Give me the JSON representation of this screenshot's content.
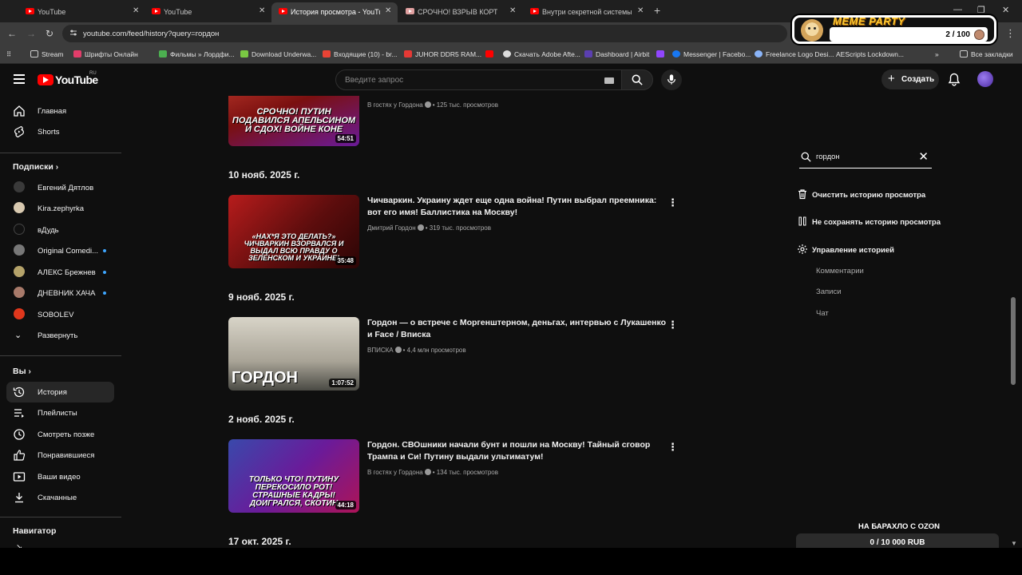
{
  "browser": {
    "tabs": [
      {
        "label": "YouTube",
        "active": false
      },
      {
        "label": "YouTube",
        "active": false
      },
      {
        "label": "История просмотра - YouTube",
        "active": true
      },
      {
        "label": "СРОЧНО! ВЗРЫВ КОРТЕЖА",
        "active": false
      },
      {
        "label": "Внутри секретной системы пр",
        "active": false
      }
    ],
    "url": "youtube.com/feed/history?query=гордон",
    "bookmarks": [
      "Stream",
      "Шрифты Онлайн",
      "Фильмы » Лордфи...",
      "Download Underwa...",
      "Входящие (10) - br...",
      "JUHOR DDR5 RAM...",
      "Скачать Adobe Afte...",
      "Dashboard | Airbit",
      "Messenger | Facebo...",
      "Freelance Logo Desi...",
      "AEScripts Lockdown...",
      "Все закладки"
    ]
  },
  "overlay": {
    "title": "MEME PARTY",
    "count": "2 / 100"
  },
  "header": {
    "logo_text": "YouTube",
    "logo_region": "RU",
    "search_placeholder": "Введите запрос",
    "create_label": "Создать"
  },
  "sidebar": {
    "main": [
      {
        "label": "Главная",
        "icon": "home-icon"
      },
      {
        "label": "Shorts",
        "icon": "shorts-icon"
      }
    ],
    "subscriptions_heading": "Подписки",
    "subscriptions": [
      {
        "label": "Евгений Дятлов",
        "dot": false,
        "color": "#3a3a3a"
      },
      {
        "label": "Kira.zephyrka",
        "dot": false,
        "color": "#d8c9b0"
      },
      {
        "label": "вДудь",
        "dot": false,
        "color": "#111111"
      },
      {
        "label": "Original Comedi...",
        "dot": true,
        "color": "#777777"
      },
      {
        "label": "АЛЕКС Брежнев",
        "dot": true,
        "color": "#b5a36a"
      },
      {
        "label": "ДНЕВНИК ХАЧА",
        "dot": true,
        "color": "#a87a6a"
      },
      {
        "label": "SOBOLEV",
        "dot": false,
        "color": "#e0371c"
      },
      {
        "label": "Развернуть",
        "dot": false,
        "color": ""
      }
    ],
    "you_heading": "Вы",
    "you": [
      {
        "label": "История",
        "icon": "history-icon",
        "active": true
      },
      {
        "label": "Плейлисты",
        "icon": "playlists-icon",
        "active": false
      },
      {
        "label": "Смотреть позже",
        "icon": "watch-later-icon",
        "active": false
      },
      {
        "label": "Понравившиеся",
        "icon": "like-icon",
        "active": false
      },
      {
        "label": "Ваши видео",
        "icon": "your-videos-icon",
        "active": false
      },
      {
        "label": "Скачанные",
        "icon": "download-icon",
        "active": false
      }
    ],
    "navigator_heading": "Навигатор"
  },
  "feed": [
    {
      "type": "video",
      "title": "",
      "channel": "В гостях у Гордона",
      "views": "125 тыс. просмотров",
      "duration": "54:51",
      "thumb_text": "СРОЧНО! ПУТИН ПОДАВИЛСЯ АПЕЛЬСИНОМ И СДОХ! ВОЙНЕ КОНЕ",
      "thumb_bg": "#8a1d1d"
    },
    {
      "type": "date",
      "label": "10 нояб. 2025 г."
    },
    {
      "type": "video",
      "title": "Чичваркин. Украину ждет еще одна война! Путин выбрал преемника: вот его имя! Баллистика на Москву!",
      "channel": "Дмитрий Гордон",
      "views": "319 тыс. просмотров",
      "duration": "35:48",
      "thumb_text": "«НАХ*Я ЭТО ДЕЛАТЬ?» ЧИЧВАРКИН ВЗОРВАЛСЯ И ВЫДАЛ ВСЮ ПРАВДУ О ЗЕЛЕНСКОМ И УКРАИНЕ!",
      "thumb_bg": "#7a1010"
    },
    {
      "type": "date",
      "label": "9 нояб. 2025 г."
    },
    {
      "type": "video",
      "title": "Гордон — о встрече с Моргенштерном, деньгах, интервью с Лукашенко и Face / Вписка",
      "channel": "ВПИСКА",
      "views": "4,4 млн просмотров",
      "duration": "1:07:52",
      "thumb_text": "ГОРДОН",
      "thumb_bg": "#c9c6bd"
    },
    {
      "type": "date",
      "label": "2 нояб. 2025 г."
    },
    {
      "type": "video",
      "title": "Гордон. СВОшники начали бунт и пошли на Москву! Тайный сговор Трампа и Си! Путину выдали ультиматум!",
      "channel": "В гостях у Гордона",
      "views": "134 тыс. просмотров",
      "duration": "44:18",
      "thumb_text": "ТОЛЬКО ЧТО! ПУТИНУ ПЕРЕКОСИЛО РОТ! СТРАШНЫЕ КАДРЫ! ДОИГРАЛСЯ, СКОТИН",
      "thumb_bg": "#2c3f8f"
    },
    {
      "type": "date",
      "label": "17 окт. 2025 г."
    }
  ],
  "history_panel": {
    "query": "гордон",
    "clear_label": "Очистить историю просмотра",
    "pause_label": "Не сохранять историю просмотра",
    "manage_label": "Управление историей",
    "sub_items": [
      "Комментарии",
      "Записи",
      "Чат"
    ]
  },
  "promo": {
    "title": "НА БАРАХЛО С OZON",
    "progress": "0 / 10 000 RUB"
  }
}
